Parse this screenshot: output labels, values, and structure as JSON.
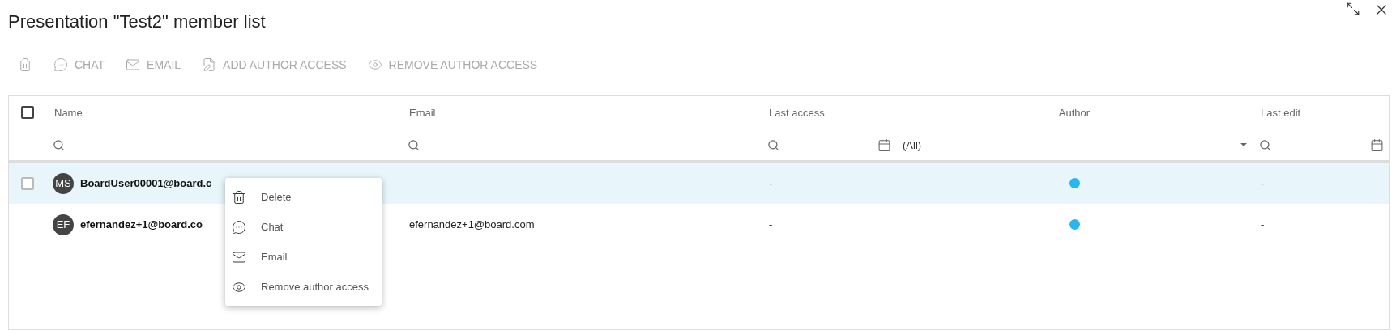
{
  "window": {
    "title": "Presentation \"Test2\" member list"
  },
  "toolbar": [
    {
      "kind": "delete",
      "disabled": true
    },
    {
      "kind": "chat",
      "label": "CHAT",
      "disabled": true
    },
    {
      "kind": "email",
      "label": "EMAIL",
      "disabled": true
    },
    {
      "kind": "add-author",
      "label": "ADD AUTHOR ACCESS",
      "disabled": true
    },
    {
      "kind": "remove-author",
      "label": "REMOVE AUTHOR ACCESS",
      "disabled": true
    }
  ],
  "table": {
    "header_checkbox": {
      "checked": false
    },
    "columns": [
      {
        "label": "Name",
        "kind": "search"
      },
      {
        "label": "Email",
        "kind": "search"
      },
      {
        "label": "Last access",
        "kind": "date"
      },
      {
        "label": "Author",
        "kind": "select",
        "value": "(All)"
      },
      {
        "label": "Last edit",
        "kind": "date"
      }
    ],
    "rows": [
      {
        "selected": true,
        "checkbox": {
          "checked": false
        },
        "initials": "MS",
        "name": "BoardUser00001@board.c",
        "last_access": "-",
        "author": true,
        "last_edit": "-"
      },
      {
        "selected": false,
        "initials": "EF",
        "name": "efernandez+1@board.co",
        "email": "efernandez+1@board.com",
        "last_access": "-",
        "author": true,
        "last_edit": "-"
      }
    ]
  },
  "context_menu": {
    "items": [
      {
        "kind": "delete",
        "label": "Delete"
      },
      {
        "kind": "chat",
        "label": "Chat"
      },
      {
        "kind": "email",
        "label": "Email"
      },
      {
        "kind": "remove-author",
        "label": "Remove author access"
      }
    ]
  }
}
